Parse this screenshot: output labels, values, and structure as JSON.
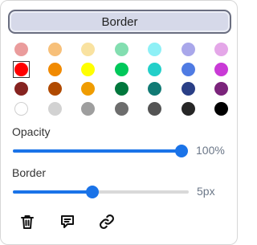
{
  "header": {
    "border_label": "Border"
  },
  "palette": {
    "rows": [
      [
        {
          "name": "rose-light",
          "color": "#ea9c9c"
        },
        {
          "name": "orange-light",
          "color": "#f7c07a"
        },
        {
          "name": "yellow-light",
          "color": "#f9e2a0"
        },
        {
          "name": "green-light",
          "color": "#83deb0"
        },
        {
          "name": "cyan-light",
          "color": "#8ef0f6"
        },
        {
          "name": "lavender-light",
          "color": "#a9a7ea"
        },
        {
          "name": "violet-light",
          "color": "#e4a7e8"
        }
      ],
      [
        {
          "name": "red",
          "color": "#ff0000",
          "selected": true
        },
        {
          "name": "orange",
          "color": "#f18a00"
        },
        {
          "name": "yellow",
          "color": "#ffff00"
        },
        {
          "name": "green",
          "color": "#00c85a"
        },
        {
          "name": "teal",
          "color": "#23cfc9"
        },
        {
          "name": "blue",
          "color": "#4f7be3"
        },
        {
          "name": "magenta",
          "color": "#c93ad6"
        }
      ],
      [
        {
          "name": "maroon",
          "color": "#862320"
        },
        {
          "name": "brown",
          "color": "#b04a00"
        },
        {
          "name": "amber",
          "color": "#ef9c00"
        },
        {
          "name": "dark-green",
          "color": "#00773c"
        },
        {
          "name": "dark-teal",
          "color": "#117a74"
        },
        {
          "name": "navy",
          "color": "#2a3f86"
        },
        {
          "name": "purple",
          "color": "#7b247b"
        }
      ],
      [
        {
          "name": "white",
          "color": "#ffffff",
          "light": true
        },
        {
          "name": "gray-lighter",
          "color": "#d2d2d2"
        },
        {
          "name": "gray-light",
          "color": "#9e9e9e"
        },
        {
          "name": "gray",
          "color": "#6d6d6d"
        },
        {
          "name": "gray-dark",
          "color": "#545454"
        },
        {
          "name": "gray-darker",
          "color": "#262626"
        },
        {
          "name": "black",
          "color": "#000000"
        }
      ]
    ]
  },
  "opacity": {
    "label": "Opacity",
    "value_text": "100%",
    "fraction": 1.0
  },
  "border": {
    "label": "Border",
    "value_text": "5px",
    "fraction": 0.45
  },
  "toolbar": {
    "icons": [
      "trash-icon",
      "comment-icon",
      "link-icon"
    ]
  },
  "colors": {
    "accent": "#1a73e8",
    "track": "#d9d9d9"
  }
}
